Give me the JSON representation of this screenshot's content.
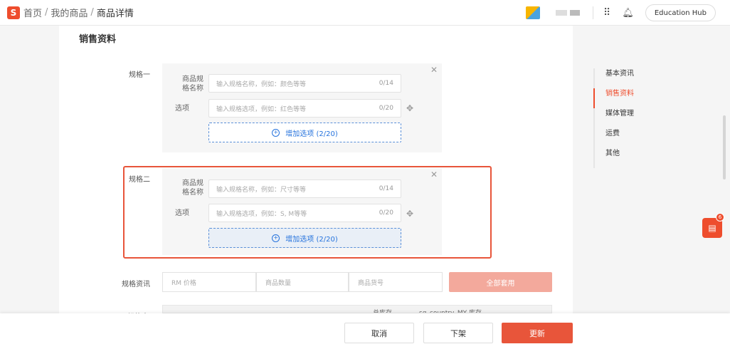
{
  "header": {
    "logo_letter": "S",
    "breadcrumbs": [
      "首页",
      "我的商品",
      "商品详情"
    ],
    "breadcrumb_sep": "/",
    "education_hub": "Education Hub"
  },
  "section": {
    "title": "销售资料"
  },
  "variation_1": {
    "label": "规格一",
    "name_label": "商品规格名称",
    "name_placeholder": "输入规格名称，例如：颜色等等",
    "name_count": "0/14",
    "option_label": "选项",
    "option_placeholder": "输入规格选项，例如：红色等等",
    "option_count": "0/20",
    "add_option": "增加选项 (2/20)"
  },
  "variation_2": {
    "label": "规格二",
    "name_label": "商品规格名称",
    "name_placeholder": "输入规格名称，例如：尺寸等等",
    "name_count": "0/14",
    "option_label": "选项",
    "option_placeholder": "输入规格选项，例如：S, M等等",
    "option_count": "0/20",
    "add_option": "增加选项 (2/20)"
  },
  "spec_info": {
    "label": "规格资讯",
    "price_placeholder": "RM 价格",
    "qty_placeholder": "商品数量",
    "sku_placeholder": "商品货号",
    "apply_all": "全部套用"
  },
  "table": {
    "label": "规格表",
    "headers": [
      "",
      "",
      "",
      "总库存",
      "sg_country_MY 库存",
      ""
    ]
  },
  "right_nav": {
    "items": [
      "基本资讯",
      "销售资料",
      "媒体管理",
      "运费",
      "其他"
    ],
    "active_index": 1
  },
  "chat": {
    "badge": "6"
  },
  "actions": {
    "cancel": "取消",
    "delist": "下架",
    "update": "更新"
  },
  "colors": {
    "brand": "#ee4d2d",
    "highlight_border": "#e8553a",
    "link_blue": "#2673dd"
  }
}
